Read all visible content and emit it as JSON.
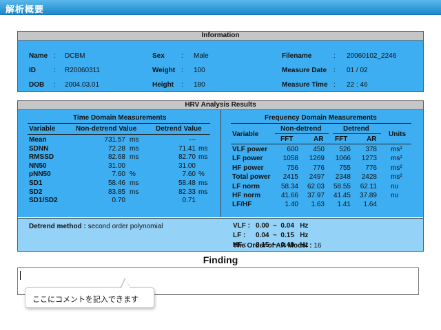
{
  "banner": {
    "title": "解析概要"
  },
  "information": {
    "title": "Information",
    "name_label": "Name",
    "name_value": "DCBM",
    "id_label": "ID",
    "id_value": "R20060311",
    "dob_label": "DOB",
    "dob_value": "2004.03.01",
    "sex_label": "Sex",
    "sex_value": "Male",
    "weight_label": "Weight",
    "weight_value": "100",
    "height_label": "Height",
    "height_value": "180",
    "filename_label": "Filename",
    "filename_value": "20060102_2246",
    "date_label": "Measure Date",
    "date_value": "01 / 02",
    "time_label": "Measure Time",
    "time_value": "22 : 46",
    "colon": ":"
  },
  "hrv": {
    "title": "HRV Analysis Results",
    "time_domain": {
      "title": "Time Domain Measurements",
      "headers": [
        "Variable",
        "Non-detrend Value",
        "Detrend Value"
      ],
      "rows": [
        {
          "var": "Mean",
          "nd": "731.57",
          "nd_unit": "ms",
          "d": "---",
          "d_unit": ""
        },
        {
          "var": "SDNN",
          "nd": "72.28",
          "nd_unit": "ms",
          "d": "71.41",
          "d_unit": "ms"
        },
        {
          "var": "RMSSD",
          "nd": "82.68",
          "nd_unit": "ms",
          "d": "82.70",
          "d_unit": "ms"
        },
        {
          "var": "NN50",
          "nd": "31.00",
          "nd_unit": "",
          "d": "31.00",
          "d_unit": ""
        },
        {
          "var": "pNN50",
          "nd": "7.60",
          "nd_unit": "%",
          "d": "7.60",
          "d_unit": "%"
        },
        {
          "var": "SD1",
          "nd": "58.46",
          "nd_unit": "ms",
          "d": "58.48",
          "d_unit": "ms"
        },
        {
          "var": "SD2",
          "nd": "83.85",
          "nd_unit": "ms",
          "d": "82.33",
          "d_unit": "ms"
        },
        {
          "var": "SD1/SD2",
          "nd": "0.70",
          "nd_unit": "",
          "d": "0.71",
          "d_unit": ""
        }
      ]
    },
    "freq_domain": {
      "title": "Frequency Domain Measurements",
      "variable_header": "Variable",
      "nondetrend_header": "Non-detrend",
      "detrend_header": "Detrend",
      "units_header": "Units",
      "fft": "FFT",
      "ar": "AR",
      "rows": [
        {
          "var": "VLF power",
          "v1": "600",
          "v2": "450",
          "v3": "526",
          "v4": "378",
          "unit": "ms²"
        },
        {
          "var": "LF power",
          "v1": "1058",
          "v2": "1269",
          "v3": "1066",
          "v4": "1273",
          "unit": "ms²"
        },
        {
          "var": "HF power",
          "v1": "756",
          "v2": "776",
          "v3": "755",
          "v4": "776",
          "unit": "ms²"
        },
        {
          "var": "Total power",
          "v1": "2415",
          "v2": "2497",
          "v3": "2348",
          "v4": "2428",
          "unit": "ms²"
        },
        {
          "var": "LF norm",
          "v1": "58.34",
          "v2": "62.03",
          "v3": "58.55",
          "v4": "62.11",
          "unit": "nu"
        },
        {
          "var": "HF norm",
          "v1": "41.66",
          "v2": "37.97",
          "v3": "41.45",
          "v4": "37.89",
          "unit": "nu"
        },
        {
          "var": "LF/HF",
          "v1": "1.40",
          "v2": "1.63",
          "v3": "1.41",
          "v4": "1.64",
          "unit": ""
        }
      ]
    },
    "detrend_method_label": "Detrend method :",
    "detrend_method_value": "second order polynomial",
    "bands": [
      {
        "label": "VLF :",
        "range": "0.00  ~  0.04   Hz"
      },
      {
        "label": "LF  :",
        "range": "0.04  ~  0.15   Hz"
      },
      {
        "label": "HF  :",
        "range": "0.15  ~  0.40   Hz"
      }
    ],
    "ar_order_label": "The Order of AR Model :",
    "ar_order_value": "16"
  },
  "finding": {
    "title": "Finding",
    "value": "",
    "callout": "ここにコメントを記入できます"
  },
  "colors": {
    "banner": "#1a86cc",
    "panel_blue": "#3eaef2",
    "panel_light": "#95d2f7",
    "header_gray": "#c6c6c6"
  }
}
